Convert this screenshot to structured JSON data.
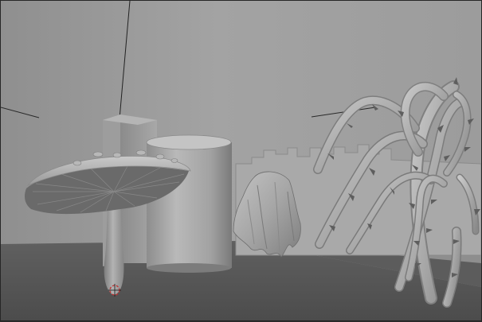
{
  "viewport": {
    "label": "",
    "shading": "solid",
    "colors": {
      "background_wall": "#9a9a9a",
      "floor": "#575757",
      "object_light": "#bdbdbd",
      "object_mid": "#8c8c8c",
      "object_dark": "#555555"
    }
  },
  "scene": {
    "objects": [
      {
        "name": "mushroom",
        "icon": "mushroom-icon"
      },
      {
        "name": "rectangular-box"
      },
      {
        "name": "cylinder"
      },
      {
        "name": "draped-cloth"
      },
      {
        "name": "tentacles"
      },
      {
        "name": "castle-wall"
      }
    ],
    "guides": [
      "light-line-left",
      "light-line-right",
      "camera-vertical-line"
    ],
    "cursor": "3d-cursor"
  }
}
